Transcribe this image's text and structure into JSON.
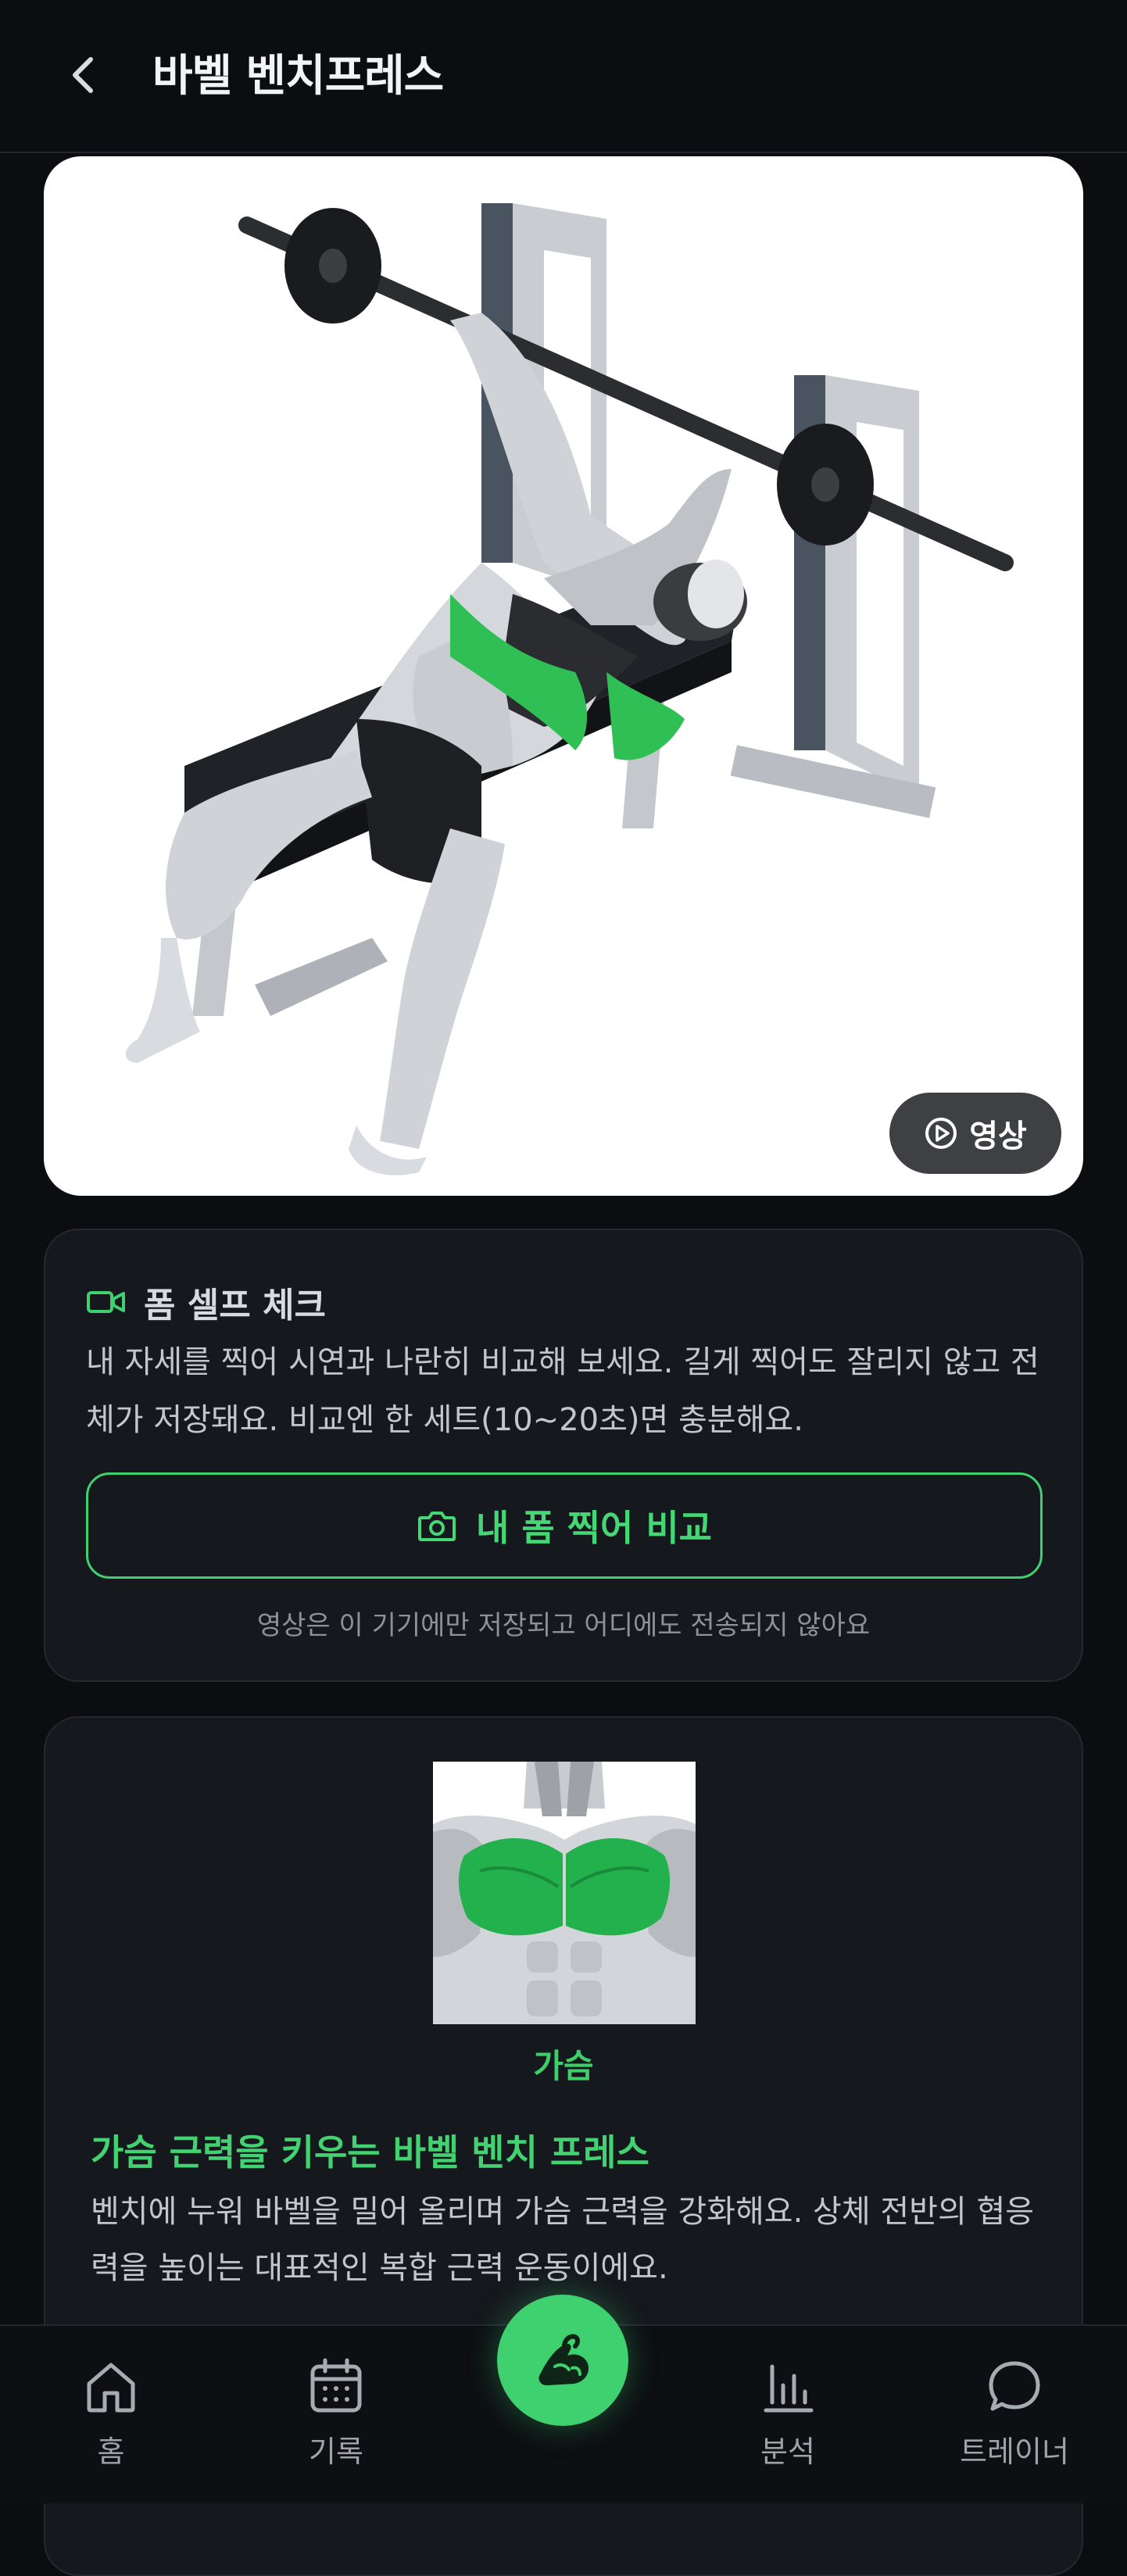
{
  "header": {
    "title": "바벨 벤치프레스"
  },
  "hero": {
    "video_label": "영상"
  },
  "form_check": {
    "title": "폼 셀프 체크",
    "description": "내 자세를 찍어 시연과 나란히 비교해 보세요. 길게 찍어도 잘리지 않고 전체가 저장돼요. 비교엔 한 세트(10~20초)면 충분해요.",
    "button_label": "내 폼 찍어 비교",
    "privacy_note": "영상은 이 기기에만 저장되고 어디에도 전송되지 않아요"
  },
  "muscle": {
    "label": "가슴",
    "heading": "가슴 근력을 키우는 바벨 벤치 프레스",
    "description": "벤치에 누워 바벨을 밀어 올리며 가슴 근력을 강화해요. 상체 전반의 협응력을 높이는 대표적인 복합 근력 운동이에요."
  },
  "nav": {
    "items": [
      {
        "label": "홈",
        "icon": "home-icon"
      },
      {
        "label": "기록",
        "icon": "calendar-icon"
      },
      {
        "label": "분석",
        "icon": "bar-chart-icon"
      },
      {
        "label": "트레이너",
        "icon": "chat-bubble-icon"
      }
    ],
    "center_icon": "muscle-arm-icon"
  },
  "colors": {
    "background": "#0b0d11",
    "card": "#15181d",
    "accent": "#3fd06f",
    "muscle_highlight": "#2fbf55"
  }
}
